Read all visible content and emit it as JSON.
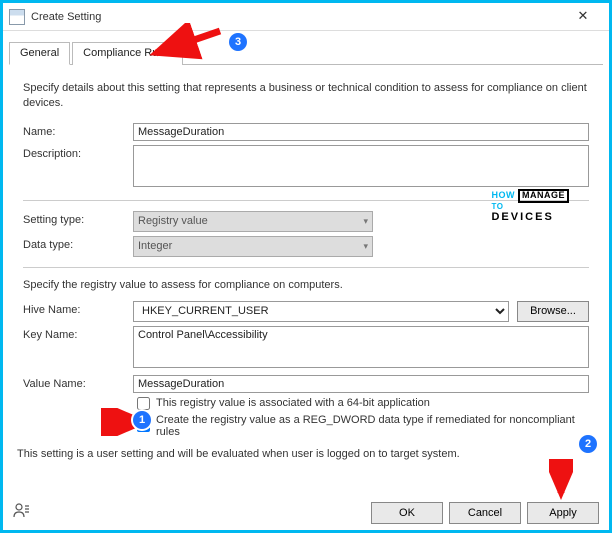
{
  "window": {
    "title": "Create Setting",
    "close": "✕"
  },
  "tabs": {
    "general": "General",
    "compliance": "Compliance Rules"
  },
  "general": {
    "intro": "Specify details about this setting that represents a business or technical condition to assess for compliance on client devices.",
    "name_label": "Name:",
    "name_value": "MessageDuration",
    "description_label": "Description:",
    "description_value": "",
    "setting_type_label": "Setting type:",
    "setting_type_value": "Registry value",
    "data_type_label": "Data type:",
    "data_type_value": "Integer",
    "registry_intro": "Specify the registry value to assess for compliance on computers.",
    "hive_label": "Hive Name:",
    "hive_value": "HKEY_CURRENT_USER",
    "browse_label": "Browse...",
    "key_label": "Key Name:",
    "key_value": "Control Panel\\Accessibility",
    "value_label": "Value Name:",
    "value_value": "MessageDuration",
    "check64_label": "This registry value is associated with a 64-bit application",
    "check64_checked": false,
    "checkdword_label": "Create the registry value as a REG_DWORD data type if remediated for noncompliant rules",
    "checkdword_checked": true,
    "footer": "This setting is a user setting and will be evaluated when user is logged on to target system."
  },
  "buttons": {
    "ok": "OK",
    "cancel": "Cancel",
    "apply": "Apply"
  },
  "annotations": {
    "badge1": "1",
    "badge2": "2",
    "badge3": "3"
  },
  "logo": {
    "line1": "HOW",
    "line2": "MANAGE",
    "line3": "DEVICES",
    "to": "TO"
  }
}
